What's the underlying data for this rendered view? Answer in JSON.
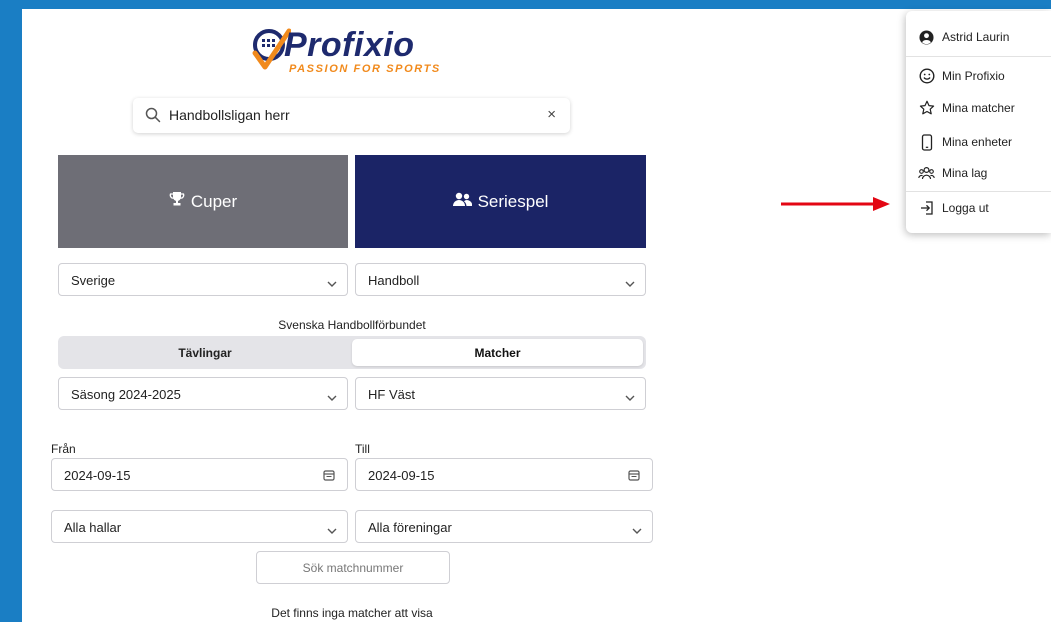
{
  "logo": {
    "word": "Profixio",
    "tagline": "PASSION FOR SPORTS"
  },
  "search": {
    "query": "Handbollsligan herr",
    "clear": "×"
  },
  "mode_buttons": {
    "cups": "Cuper",
    "series": "Seriespel"
  },
  "filters": {
    "country": "Sverige",
    "sport": "Handboll",
    "federation": "Svenska Handbollförbundet",
    "tabs": [
      "Tävlingar",
      "Matcher"
    ],
    "active_tab": "Matcher",
    "season": "Säsong 2024-2025",
    "region": "HF Väst",
    "from_label": "Från",
    "from_value": "2024-09-15",
    "to_label": "Till",
    "to_value": "2024-09-15",
    "venue": "Alla hallar",
    "clubs": "Alla föreningar",
    "match_number_placeholder": "Sök matchnummer"
  },
  "empty_message": "Det finns inga matcher att visa",
  "user_menu": {
    "user_name": "Astrid Laurin",
    "items": [
      "Min Profixio",
      "Mina matcher",
      "Mina enheter",
      "Mina lag",
      "Logga ut"
    ]
  },
  "colors": {
    "background": "#1a7ec4",
    "cups_button": "#6e6e76",
    "series_button": "#1b2466",
    "annotation_arrow": "#e30613",
    "logo_navy": "#1e2a6e",
    "logo_orange": "#f18a1c"
  }
}
